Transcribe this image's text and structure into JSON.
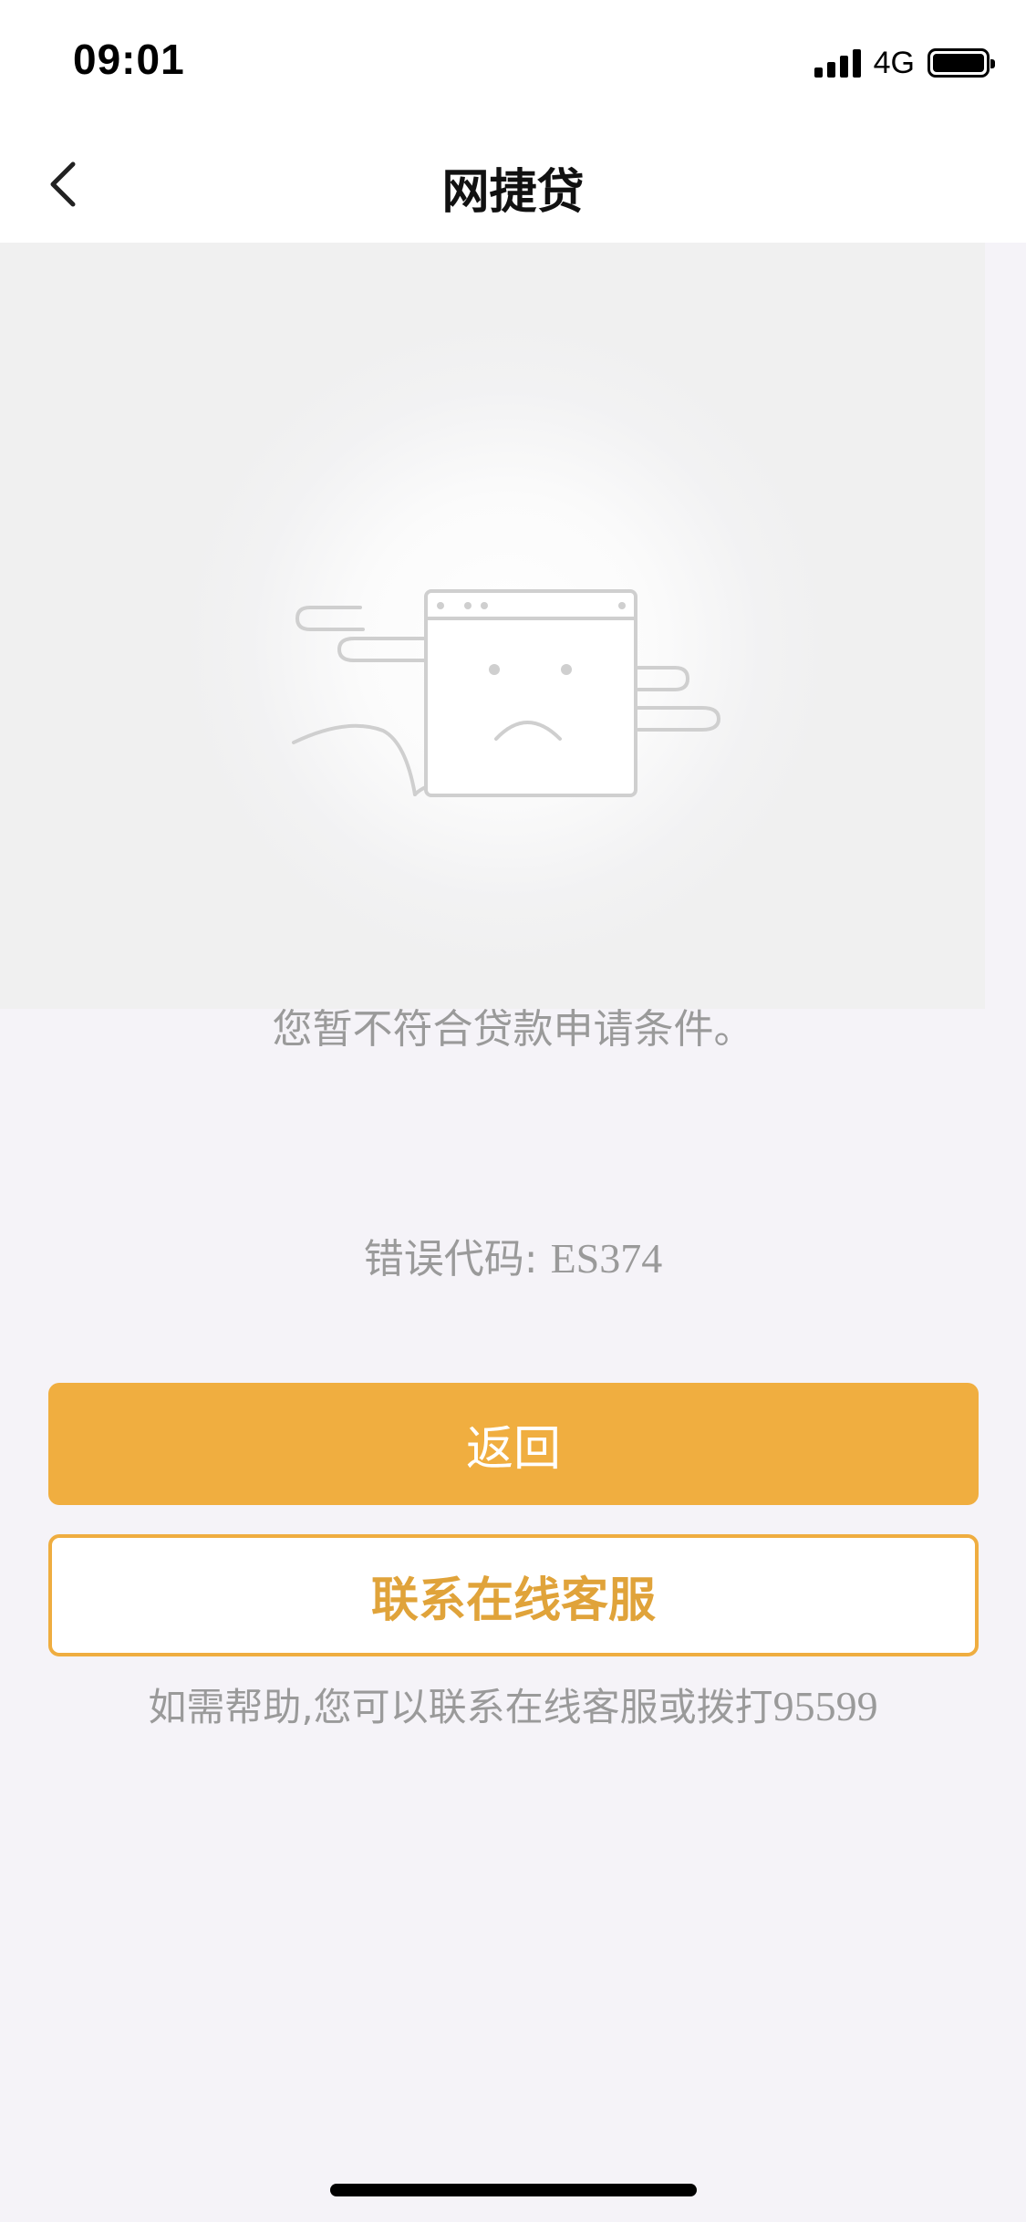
{
  "status_bar": {
    "time": "09:01",
    "network": "4G"
  },
  "nav": {
    "title": "网捷贷",
    "back_icon": "chevron-left-icon"
  },
  "illustration": {
    "icon": "sad-browser-window-icon"
  },
  "content": {
    "message": "您暂不符合贷款申请条件。",
    "error_label": "错误代码:",
    "error_code": "ES374"
  },
  "actions": {
    "back_label": "返回",
    "contact_label": "联系在线客服"
  },
  "help": {
    "text": "如需帮助,您可以联系在线客服或拨打",
    "phone": "95599"
  },
  "colors": {
    "accent": "#f0ae40",
    "outline_text": "#e0a33a",
    "muted_text": "#9a9a9a",
    "page_bg": "#f5f3f8"
  }
}
